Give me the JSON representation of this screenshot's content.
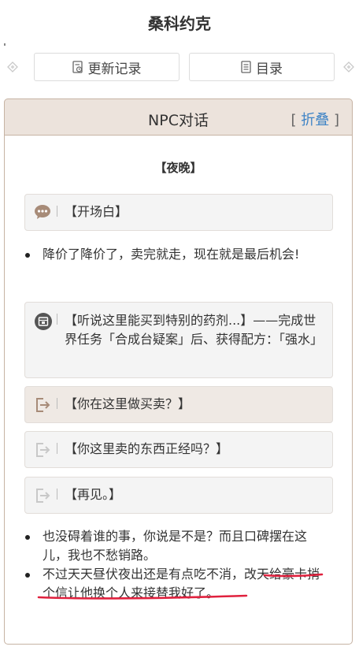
{
  "page": {
    "title": "桑科约克"
  },
  "toolbar": {
    "update_log": "更新记录",
    "contents": "目录"
  },
  "panel": {
    "title": "NPC对话",
    "collapse_prefix": "[",
    "collapse_link": "折叠",
    "collapse_suffix": "]",
    "section": "【夜晚】",
    "opening_label": "【开场白】",
    "opening_lines": [
      "降价了降价了，卖完就走，现在就是最后机会!"
    ],
    "options": [
      {
        "text": "【听说这里能买到特别的药剂...】——完成世界任务「合成台疑案」后、获得配方：「强水」",
        "icon": "quest-icon"
      },
      {
        "text": "【你在这里做买卖？】",
        "icon": "exit-icon",
        "selected": true
      },
      {
        "text": "【你这里卖的东西正经吗？】",
        "icon": "exit-icon"
      },
      {
        "text": "【再见。】",
        "icon": "exit-icon"
      }
    ],
    "reply_lines": [
      "也没碍着谁的事，你说是不是？而且口碑摆在这儿，我也不愁销路。",
      "不过天天昼伏夜出还是有点吃不消，改天给豪卡捎个信让他换个人来接替我好了。"
    ]
  },
  "colors": {
    "accent": "#3f84c6",
    "header_bg": "#ece3dc",
    "border": "#c6b3a3",
    "scribble": "#e0213e",
    "icon": "#a78b78"
  }
}
